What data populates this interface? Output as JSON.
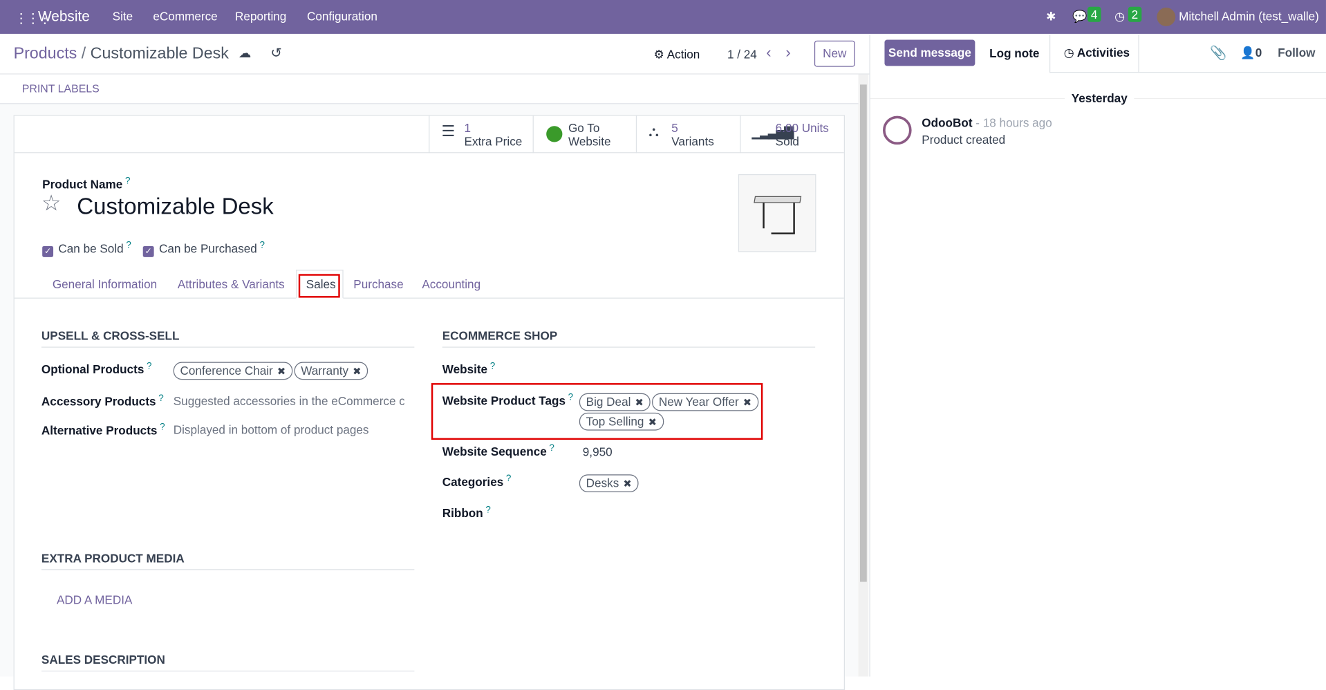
{
  "navbar": {
    "app": "Website",
    "menus": [
      "Site",
      "eCommerce",
      "Reporting",
      "Configuration"
    ],
    "messages_count": "4",
    "activities_count": "2",
    "user": "Mitchell Admin (test_walle)"
  },
  "control_panel": {
    "breadcrumb_parent": "Products",
    "breadcrumb_sep": "/",
    "breadcrumb_current": "Customizable Desk",
    "action": "Action",
    "pager": "1 / 24",
    "new": "New"
  },
  "print_labels": "PRINT LABELS",
  "smart_buttons": [
    {
      "value": "1",
      "label": "Extra Price"
    },
    {
      "value": "Go To",
      "label": "Website"
    },
    {
      "value": "5",
      "label": "Variants"
    },
    {
      "value": "6.00 Units",
      "label": "Sold"
    }
  ],
  "product": {
    "name_label": "Product Name",
    "name": "Customizable Desk",
    "can_be_sold": "Can be Sold",
    "can_be_purchased": "Can be Purchased"
  },
  "tabs": [
    "General Information",
    "Attributes & Variants",
    "Sales",
    "Purchase",
    "Accounting"
  ],
  "upsell": {
    "title": "UPSELL & CROSS-SELL",
    "optional_label": "Optional Products",
    "optional_tags": [
      "Conference Chair",
      "Warranty"
    ],
    "accessory_label": "Accessory Products",
    "accessory_placeholder": "Suggested accessories in the eCommerce cart",
    "alternative_label": "Alternative Products",
    "alternative_placeholder": "Displayed in bottom of product pages"
  },
  "ecommerce": {
    "title": "ECOMMERCE SHOP",
    "website_label": "Website",
    "tags_label": "Website Product Tags",
    "tags": [
      "Big Deal",
      "New Year Offer",
      "Top Selling"
    ],
    "sequence_label": "Website Sequence",
    "sequence": "9,950",
    "categories_label": "Categories",
    "categories": [
      "Desks"
    ],
    "ribbon_label": "Ribbon"
  },
  "media": {
    "title": "EXTRA PRODUCT MEDIA",
    "add": "ADD A MEDIA"
  },
  "sales_description": {
    "title": "SALES DESCRIPTION"
  },
  "chatter": {
    "send": "Send message",
    "log": "Log note",
    "activities": "Activities",
    "followers": "0",
    "follow": "Follow",
    "date": "Yesterday",
    "author": "OdooBot",
    "time": "- 18 hours ago",
    "body": "Product created"
  },
  "colors": {
    "brand": "#71639e",
    "highlight": "#e00000"
  }
}
